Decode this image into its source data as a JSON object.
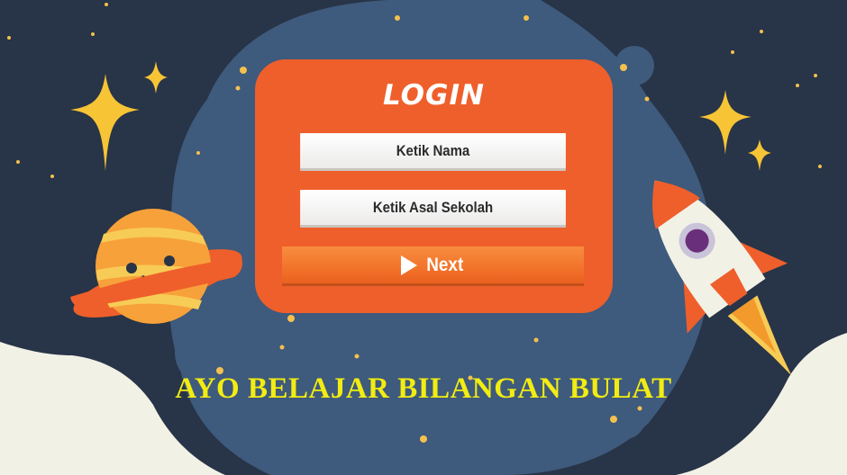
{
  "login": {
    "title": "LOGIN",
    "name_placeholder": "Ketik Nama",
    "school_placeholder": "Ketik Asal Sekolah",
    "next_label": "Next"
  },
  "headline": "AYO BELAJAR BILANGAN BULAT",
  "icons": {
    "next": "play-triangle-icon",
    "decor": [
      "star-icon",
      "planet-icon",
      "rocket-icon"
    ]
  },
  "colors": {
    "background": "#283447",
    "blob": "#3e5a7c",
    "card": "#ef5f2b",
    "button": "#f3752c",
    "headline": "#f2ec12",
    "corner": "#f2f1e6"
  }
}
